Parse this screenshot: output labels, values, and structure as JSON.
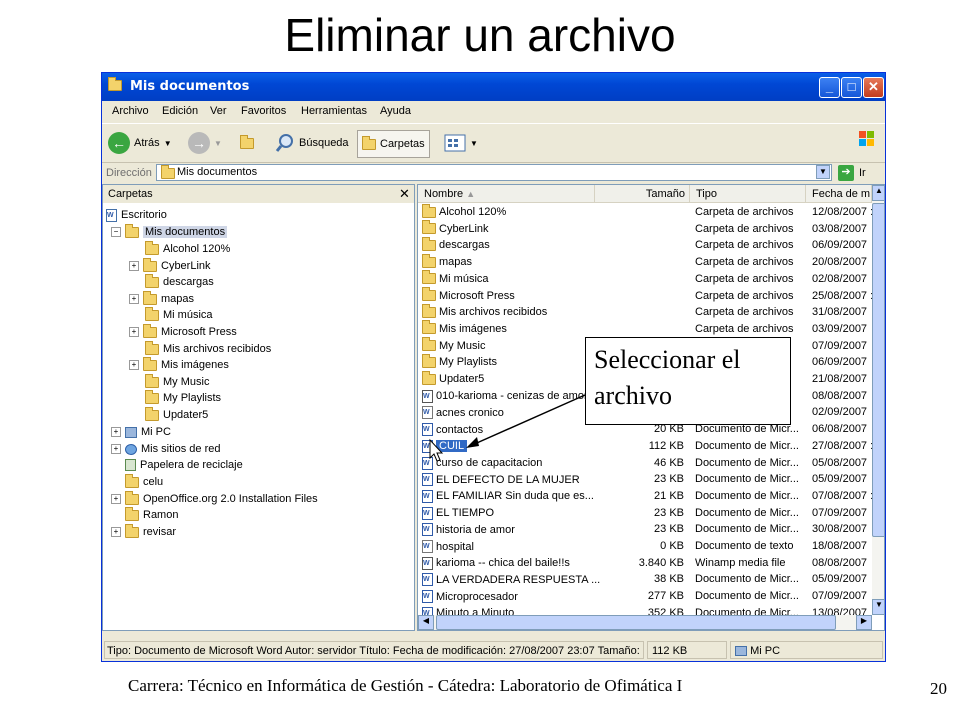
{
  "slide": {
    "title": "Eliminar un archivo",
    "footer": "Carrera: Técnico en Informática de Gestión - Cátedra: Laboratorio de Ofimática I",
    "page_number": "20",
    "callout": "Seleccionar el archivo"
  },
  "window": {
    "title": "Mis documentos",
    "menu": [
      "Archivo",
      "Edición",
      "Ver",
      "Favoritos",
      "Herramientas",
      "Ayuda"
    ],
    "toolbar": {
      "back": "Atrás",
      "search": "Búsqueda",
      "folders": "Carpetas"
    },
    "address": {
      "label": "Dirección",
      "value": "Mis documentos",
      "go": "Ir"
    },
    "tree": {
      "header": "Carpetas",
      "items": [
        "Escritorio",
        "Mis documentos",
        "Alcohol 120%",
        "CyberLink",
        "descargas",
        "mapas",
        "Mi música",
        "Microsoft Press",
        "Mis archivos recibidos",
        "Mis imágenes",
        "My Music",
        "My Playlists",
        "Updater5",
        "Mi PC",
        "Mis sitios de red",
        "Papelera de reciclaje",
        "celu",
        "OpenOffice.org 2.0 Installation Files",
        "Ramon",
        "revisar"
      ]
    },
    "columns": [
      "Nombre",
      "Tamaño",
      "Tipo",
      "Fecha de m"
    ],
    "files": [
      {
        "name": "Alcohol 120%",
        "size": "",
        "type": "Carpeta de archivos",
        "date": "12/08/2007 :",
        "icon": "folder"
      },
      {
        "name": "CyberLink",
        "size": "",
        "type": "Carpeta de archivos",
        "date": "03/08/2007",
        "icon": "folder"
      },
      {
        "name": "descargas",
        "size": "",
        "type": "Carpeta de archivos",
        "date": "06/09/2007",
        "icon": "folder"
      },
      {
        "name": "mapas",
        "size": "",
        "type": "Carpeta de archivos",
        "date": "20/08/2007",
        "icon": "folder"
      },
      {
        "name": "Mi música",
        "size": "",
        "type": "Carpeta de archivos",
        "date": "02/08/2007",
        "icon": "folder"
      },
      {
        "name": "Microsoft Press",
        "size": "",
        "type": "Carpeta de archivos",
        "date": "25/08/2007 :",
        "icon": "folder"
      },
      {
        "name": "Mis archivos recibidos",
        "size": "",
        "type": "Carpeta de archivos",
        "date": "31/08/2007",
        "icon": "folder"
      },
      {
        "name": "Mis imágenes",
        "size": "",
        "type": "Carpeta de archivos",
        "date": "03/09/2007",
        "icon": "folder"
      },
      {
        "name": "My Music",
        "size": "",
        "type": "",
        "date": "07/09/2007",
        "icon": "folder"
      },
      {
        "name": "My Playlists",
        "size": "",
        "type": "",
        "date": "06/09/2007",
        "icon": "folder"
      },
      {
        "name": "Updater5",
        "size": "",
        "type": "",
        "date": "21/08/2007",
        "icon": "folder"
      },
      {
        "name": "010-karioma - cenizas de amor",
        "size": "",
        "type": "",
        "date": "08/08/2007",
        "icon": "audio"
      },
      {
        "name": "acnes cronico",
        "size": "",
        "type": "",
        "date": "02/09/2007",
        "icon": "text"
      },
      {
        "name": "contactos",
        "size": "20 KB",
        "type": "Documento de Micr...",
        "date": "06/08/2007",
        "icon": "word"
      },
      {
        "name": "CUIL",
        "size": "112 KB",
        "type": "Documento de Micr...",
        "date": "27/08/2007 :",
        "icon": "word",
        "selected": true
      },
      {
        "name": "curso de capacitacion",
        "size": "46 KB",
        "type": "Documento de Micr...",
        "date": "05/08/2007",
        "icon": "word"
      },
      {
        "name": "EL DEFECTO DE LA MUJER",
        "size": "23 KB",
        "type": "Documento de Micr...",
        "date": "05/09/2007",
        "icon": "word"
      },
      {
        "name": "EL FAMILIAR Sin duda que es...",
        "size": "21 KB",
        "type": "Documento de Micr...",
        "date": "07/08/2007 :",
        "icon": "word"
      },
      {
        "name": "EL TIEMPO",
        "size": "23 KB",
        "type": "Documento de Micr...",
        "date": "07/09/2007",
        "icon": "word"
      },
      {
        "name": "historia de amor",
        "size": "23 KB",
        "type": "Documento de Micr...",
        "date": "30/08/2007",
        "icon": "word"
      },
      {
        "name": "hospital",
        "size": "0 KB",
        "type": "Documento de texto",
        "date": "18/08/2007",
        "icon": "text"
      },
      {
        "name": "karioma -- chica del baile!!s",
        "size": "3.840 KB",
        "type": "Winamp media file",
        "date": "08/08/2007",
        "icon": "audio"
      },
      {
        "name": "LA VERDADERA RESPUESTA ...",
        "size": "38 KB",
        "type": "Documento de Micr...",
        "date": "05/09/2007",
        "icon": "word"
      },
      {
        "name": "Microprocesador",
        "size": "277 KB",
        "type": "Documento de Micr...",
        "date": "07/09/2007",
        "icon": "word"
      },
      {
        "name": "Minuto a Minuto",
        "size": "352 KB",
        "type": "Documento de Micr...",
        "date": "13/08/2007",
        "icon": "word"
      }
    ],
    "status": {
      "info": "Tipo: Documento de Microsoft Word Autor: servidor Título: Fecha de modificación: 27/08/2007 23:07 Tamaño: 112",
      "size": "112 KB",
      "location": "Mi PC"
    }
  }
}
